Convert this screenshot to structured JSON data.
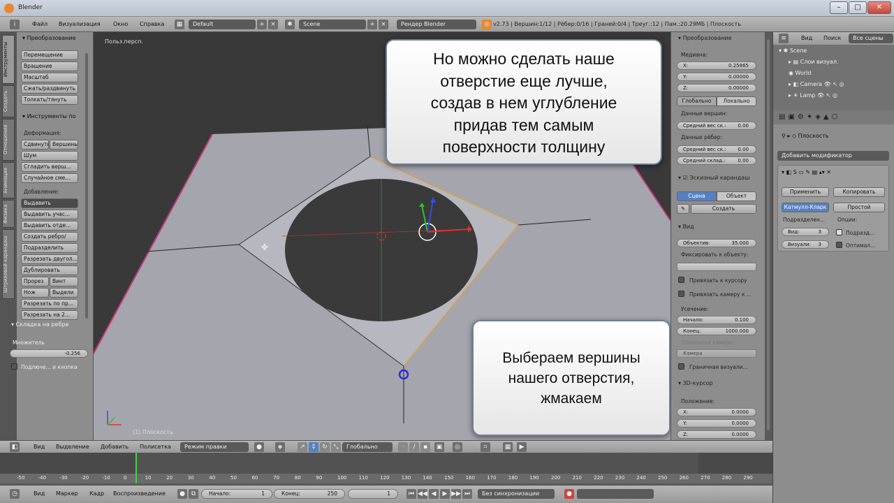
{
  "window": {
    "title": "Blender",
    "minimize": "–",
    "maximize": "□",
    "close": "✕"
  },
  "header": {
    "menus": [
      "Файл",
      "Визуализация",
      "Окно",
      "Справка"
    ],
    "layout": "Default",
    "scene": "Scene",
    "engine": "Рендер Blender",
    "stats": "v2.73 | Вершин:1/12 | Рёбер:0/16 | Граней:0/4 | Треуг.:12 | Пам.:20.29МБ | Плоскость"
  },
  "tabs": [
    "Инструменты",
    "Создать",
    "Отношения",
    "Анимация",
    "Физика",
    "Штриховой карандаш"
  ],
  "toolshelf": {
    "transform_title": "Преобразование",
    "transform_buttons": [
      "Перемещение",
      "Вращение",
      "Масштаб",
      "Сжать/раздвинуть",
      "Толкать/тянуть"
    ],
    "mesh_tools_title": "Инструменты по",
    "deform_label": "Деформация:",
    "deform_row": [
      "Сдвинуть",
      "Вершины"
    ],
    "deform_buttons": [
      "Шум",
      "Сгладить верш...",
      "Случайное сме..."
    ],
    "add_label": "Добавление:",
    "add_select": "Выдавить",
    "add_buttons": [
      "Выдавить учас...",
      "Выдавить отде...",
      "Создать ребро/",
      "Подразделить",
      "Разрезать двугол...",
      "Дублировать"
    ],
    "row_a": [
      "Прорез",
      "Винт"
    ],
    "row_b": [
      "Нож",
      "Выдели"
    ],
    "more_buttons": [
      "Разрезать по пр...",
      "Разрезать на 2..."
    ],
    "operator_title": "Складка на ребре",
    "multiplier_label": "Множитель",
    "multiplier_value": "-0.256",
    "snap_label": "Подлюче... и кнопка"
  },
  "viewport": {
    "view_label": "Польз.персп.",
    "object_label": "(1) Плоскость",
    "callout_top": [
      "Но можно сделать наше",
      "отверстие еще лучше,",
      "создав в нем углубление",
      "придав тем самым",
      "поверхности толщину"
    ],
    "callout_bottom": [
      "Выбераем вершины",
      "нашего отверстия,",
      "жмакаем"
    ]
  },
  "npanel": {
    "transform_title": "Преобразование",
    "median_label": "Медиана:",
    "x": {
      "label": "X:",
      "value": "0.25865"
    },
    "y": {
      "label": "Y:",
      "value": "0.00000"
    },
    "z": {
      "label": "Z:",
      "value": "0.00000"
    },
    "global_label": "Глобально",
    "local_label": "Локально",
    "vertex_data_label": "Данные вершин:",
    "mean_bevel_vertex": {
      "label": "Средний вес ск.:",
      "value": "0.00"
    },
    "edge_data_label": "Данные рёбер:",
    "mean_bevel_edge": {
      "label": "Средний вес ск.:",
      "value": "0.00"
    },
    "mean_crease": {
      "label": "Средний склад.:",
      "value": "0.00"
    },
    "gp_title": "Эскизный карандаш",
    "gp_scene": "Сцена",
    "gp_object": "Объект",
    "gp_new": "Создать",
    "view_title": "Вид",
    "lens": {
      "label": "Объектив:",
      "value": "35.000"
    },
    "lock_to_object": "Фиксировать к объекту:",
    "lock_to_cursor": "Привязать к курсору",
    "lock_camera": "Привязать камеру к ...",
    "clip_label": "Усечение:",
    "clip_start": {
      "label": "Начало:",
      "value": "0.100"
    },
    "clip_end": {
      "label": "Конец:",
      "value": "1000.000"
    },
    "local_camera_label": "Локальная камера:",
    "camera_field": "Камера",
    "render_border": "Граничная визуали...",
    "cursor_title": "3D-курсор",
    "location_label": "Положение:",
    "cx": {
      "label": "X:",
      "value": "0.0000"
    },
    "cy": {
      "label": "Y:",
      "value": "0.0000"
    },
    "cz": {
      "label": "Z:",
      "value": "0.0000"
    }
  },
  "outliner": {
    "view": "Вид",
    "search": "Поиск",
    "all_scenes": "Все сцены",
    "items": [
      "Scene",
      "Слои визуал.",
      "World",
      "Camera",
      "Lamp"
    ]
  },
  "properties": {
    "object_name": "Плоскость",
    "add_modifier": "Добавить модификатор",
    "apply": "Применить",
    "copy": "Копировать",
    "catmull": "Катмулл-Кларк",
    "simple": "Простой",
    "subdiv_label": "Подразделен...",
    "options_label": "Опции:",
    "view_field": {
      "label": "Вид:",
      "value": "3"
    },
    "render_field": {
      "label": "Визуали:",
      "value": "3"
    },
    "opt1": "Подразд...",
    "opt2": "Оптимал..."
  },
  "view3d_header": {
    "menus": [
      "Вид",
      "Выделение",
      "Добавить",
      "Полисетка"
    ],
    "mode": "Режим правки",
    "orientation": "Глобально"
  },
  "timeline": {
    "ticks": [
      "-50",
      "-40",
      "-30",
      "-20",
      "-10",
      "0",
      "10",
      "20",
      "30",
      "40",
      "50",
      "60",
      "70",
      "80",
      "90",
      "100",
      "110",
      "120",
      "130",
      "140",
      "150",
      "160",
      "170",
      "180",
      "190",
      "200",
      "210",
      "220",
      "230",
      "240",
      "250",
      "260",
      "270",
      "280",
      "290"
    ],
    "menus": [
      "Вид",
      "Маркер",
      "Кадр",
      "Воспроизведение"
    ],
    "start": {
      "label": "Начало:",
      "value": "1"
    },
    "end": {
      "label": "Конец:",
      "value": "250"
    },
    "current": "1",
    "sync": "Без синхронизации"
  },
  "colors": {
    "accent": "#5680c2",
    "mesh_face": "#a5a5ad",
    "hole": "#3a3a3a",
    "selected_vertex": "#2b2bd8",
    "edge_highlight": "#d8a040"
  }
}
